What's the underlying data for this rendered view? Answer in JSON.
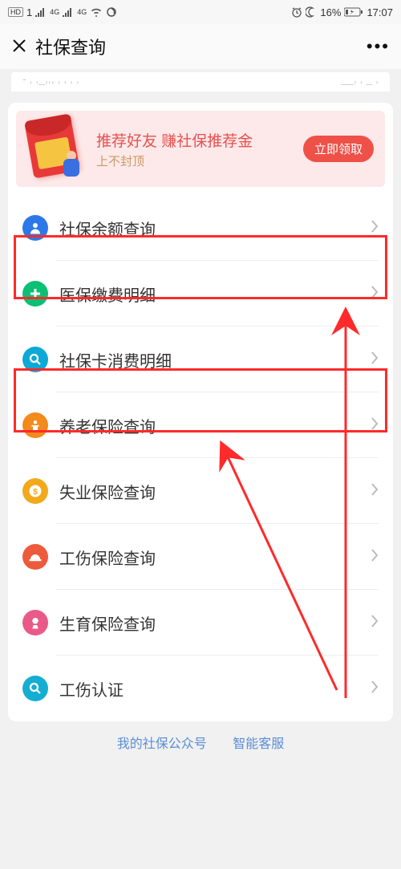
{
  "status": {
    "hd": "HD",
    "sim": "1",
    "net1": "4G",
    "net2": "4G",
    "alarm": "⏰",
    "moon": "☾",
    "battery": "16%",
    "batteryIcon": "▸",
    "time": "17:07",
    "wifi": "wifi",
    "signal": "sig",
    "swirl": "⟳"
  },
  "nav": {
    "title": "社保查询"
  },
  "topHint": {
    "left": "- , ,_,,, , , , ,",
    "right": "__, , _ ,"
  },
  "promo": {
    "title1": "推荐好友 ",
    "title2": "赚社保推荐金",
    "sub": "上不封顶",
    "btn": "立即领取"
  },
  "items": [
    {
      "label": "社保余额查询",
      "icon": "user",
      "tone": "c-blue"
    },
    {
      "label": "医保缴费明细",
      "icon": "plus",
      "tone": "c-green"
    },
    {
      "label": "社保卡消费明细",
      "icon": "search",
      "tone": "c-teal"
    },
    {
      "label": "养老保险查询",
      "icon": "person",
      "tone": "c-orange"
    },
    {
      "label": "失业保险查询",
      "icon": "coin",
      "tone": "c-gold"
    },
    {
      "label": "工伤保险查询",
      "icon": "hardhat",
      "tone": "c-red"
    },
    {
      "label": "生育保险查询",
      "icon": "baby",
      "tone": "c-pink"
    },
    {
      "label": "工伤认证",
      "icon": "search",
      "tone": "c-teal2"
    }
  ],
  "footer": {
    "a": "我的社保公众号",
    "b": "智能客服"
  }
}
